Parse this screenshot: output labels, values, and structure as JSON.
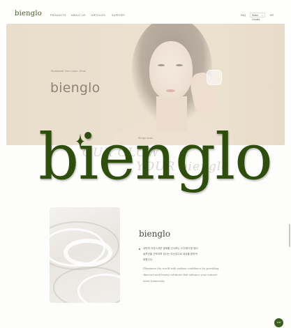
{
  "header": {
    "logo": "bienglo",
    "nav": [
      "PRODUCTS",
      "ABOUT US",
      "ARTICLES",
      "SUPPORT"
    ],
    "utility": [
      "FAQ"
    ],
    "language": {
      "selected": "Select Country",
      "right_label": "KR"
    }
  },
  "hero": {
    "tagline": "Illuminate Your Inner Glow",
    "brand": "bienglo",
    "caption": "Bienglo studio"
  },
  "overlay": {
    "giant_logo": "bienglo",
    "ghost_line_1": "OUR GLOW",
    "ghost_line_2": "YOUR bienglo"
  },
  "product": {
    "title": "bienglo",
    "korean_lines": [
      "내면의 자연스러운 광채를 선사하는 스킨케어 및 뷰티",
      "솔루션을 선보이며 빛나는 자신감으로 세상을 환하게",
      "밝힙니다."
    ],
    "english_lines": [
      "Illuminate the world with radiant confidence by providing",
      "skincare and beauty solutions that enhance your natural",
      "inner luminosity."
    ]
  },
  "floating": {
    "top_button": "TOP"
  },
  "colors": {
    "brand_green": "#2e4f0c",
    "accent_green": "#3b5e1c",
    "hero_beige": "#e8dbc7"
  }
}
